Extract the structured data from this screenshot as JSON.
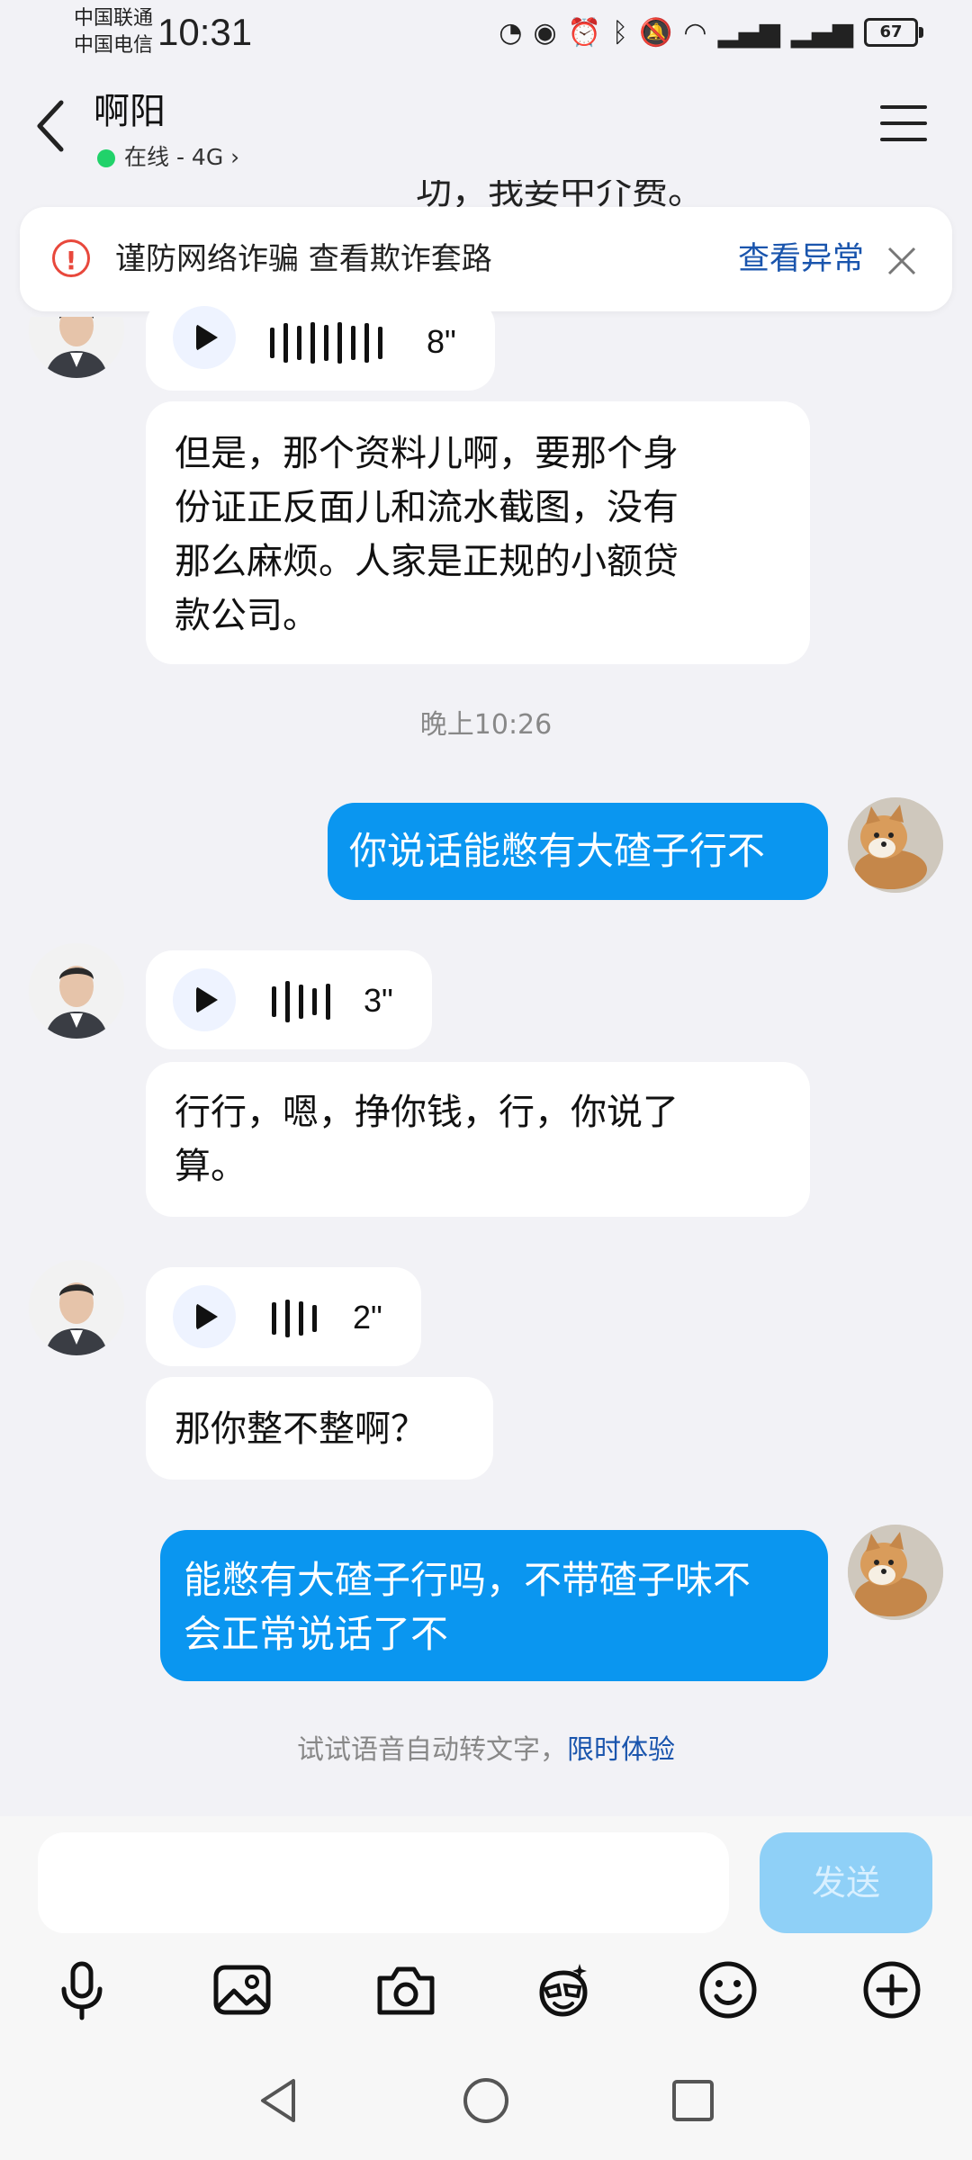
{
  "status_bar": {
    "carrier_1": "中国联通",
    "carrier_2": "中国电信",
    "time": "10:31",
    "battery": "67"
  },
  "header": {
    "contact_name": "啊阳",
    "status": "在线 - 4G",
    "status_color": "#21d26a"
  },
  "cut_text": "功，我妾中介费。",
  "banner": {
    "text": "谨防网络诈骗 查看欺诈套路",
    "link": "查看异常",
    "icon_color": "#e8483c"
  },
  "messages": [
    {
      "type": "voice",
      "from": "contact",
      "duration": "8\""
    },
    {
      "type": "text",
      "from": "contact",
      "lines": [
        "但是，那个资料儿啊，要那个身",
        "份证正反面儿和流水截图，没有",
        "那么麻烦。人家是正规的小额贷",
        "款公司。"
      ]
    },
    {
      "type": "time",
      "text": "晚上10:26"
    },
    {
      "type": "text",
      "from": "me",
      "lines": [
        "你说话能憋有大碴子行不"
      ]
    },
    {
      "type": "voice",
      "from": "contact",
      "duration": "3\""
    },
    {
      "type": "text",
      "from": "contact",
      "lines": [
        "行行，嗯，挣你钱，行，你说了",
        "算。"
      ]
    },
    {
      "type": "voice",
      "from": "contact",
      "duration": "2\""
    },
    {
      "type": "text",
      "from": "contact",
      "lines": [
        "那你整不整啊？"
      ]
    },
    {
      "type": "text",
      "from": "me",
      "lines": [
        "能憋有大碴子行吗，不带碴子味不",
        "会正常说话了不"
      ]
    }
  ],
  "hint": {
    "text": "试试语音自动转文字，",
    "link": "限时体验"
  },
  "input": {
    "placeholder": "",
    "send_label": "发送"
  },
  "toolbar_icons": [
    "microphone-icon",
    "image-icon",
    "camera-icon",
    "sticker-icon",
    "emoji-icon",
    "plus-icon"
  ],
  "accent_color": "#0a96f0"
}
